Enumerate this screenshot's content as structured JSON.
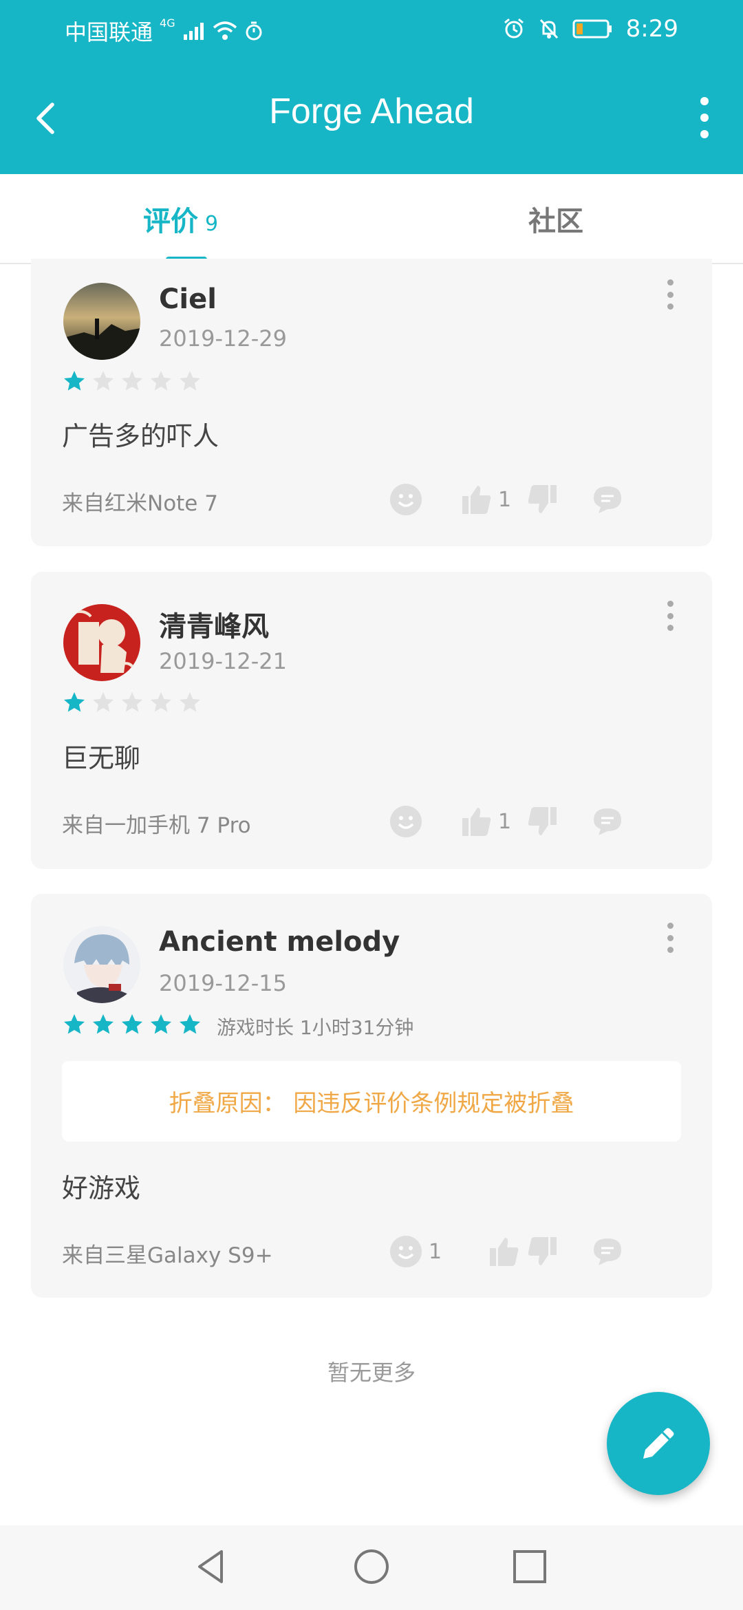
{
  "status_bar": {
    "carrier": "中国联通",
    "network": "4G",
    "time": "8:29"
  },
  "app_bar": {
    "title": "Forge Ahead"
  },
  "tabs": [
    {
      "label": "评价",
      "count": "9",
      "active": true
    },
    {
      "label": "社区",
      "active": false
    }
  ],
  "reviews": [
    {
      "user": "Ciel",
      "date": "2019-12-29",
      "rating": 1,
      "content": "广告多的吓人",
      "device": "来自红米Note 7",
      "likes": "1"
    },
    {
      "user": "清青峰风",
      "date": "2019-12-21",
      "rating": 1,
      "content": "巨无聊",
      "device": "来自一加手机 7 Pro",
      "likes": "1"
    },
    {
      "user": "Ancient melody",
      "date": "2019-12-15",
      "rating": 5,
      "playtime": "游戏时长 1小时31分钟",
      "fold_notice": "折叠原因： 因违反评价条例规定被折叠",
      "content": "好游戏",
      "device": "来自三星Galaxy S9+",
      "funny": "1"
    }
  ],
  "footer": {
    "no_more": "暂无更多"
  },
  "colors": {
    "accent": "#16b6c6",
    "star_empty": "#e2e2e2",
    "fold_text": "#f0a846"
  }
}
